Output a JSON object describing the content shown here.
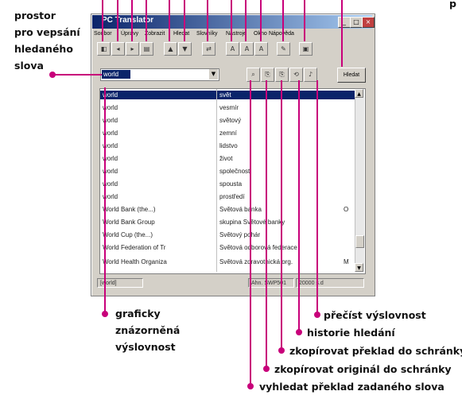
{
  "window": {
    "title": "PC Translator",
    "controls": [
      "_",
      "□",
      "×"
    ]
  },
  "menu": [
    "Soubor",
    "Úpravy",
    "Zobrazit",
    "Hledat",
    "Slovníky",
    "Nástroje",
    "Okno",
    "Nápověda"
  ],
  "search": {
    "value": "world",
    "button_label": "Hledat"
  },
  "results": [
    {
      "original": "world",
      "translation": "svět",
      "extra": ""
    },
    {
      "original": "world",
      "translation": "vesmír",
      "extra": ""
    },
    {
      "original": "world",
      "translation": "světový",
      "extra": ""
    },
    {
      "original": "world",
      "translation": "zemní",
      "extra": ""
    },
    {
      "original": "world",
      "translation": "lidstvo",
      "extra": ""
    },
    {
      "original": "world",
      "translation": "život",
      "extra": ""
    },
    {
      "original": "world",
      "translation": "společnost",
      "extra": ""
    },
    {
      "original": "world",
      "translation": "spousta",
      "extra": ""
    },
    {
      "original": "world",
      "translation": "prostředí",
      "extra": ""
    },
    {
      "original": "World Bank (the...)",
      "translation": "Světová banka",
      "extra": "O"
    },
    {
      "original": "World Bank Group",
      "translation": "skupina Světové banky",
      "extra": ""
    },
    {
      "original": "World Cup (the...)",
      "translation": "Světový pohár",
      "extra": ""
    },
    {
      "original": "World Federation of Tr",
      "translation": "Světová odborová federace",
      "extra": ""
    },
    {
      "original": "World Health Organiza",
      "translation": "Světová zdravotnická org.",
      "extra": "M"
    }
  ],
  "status": {
    "left": "[world]",
    "middle": "Ahn. SWP501",
    "right": "20000 s.d"
  },
  "annotations": {
    "search_field": [
      "prostor",
      "pro vepsání",
      "hledaného",
      "slova"
    ],
    "pronunciation": [
      "graficky",
      "znázorněná",
      "výslovnost"
    ],
    "read_pronunciation": "přečíst výslovnost",
    "history": "historie hledání",
    "copy_translation": "zkopírovat překlad do schránky",
    "copy_original": "zkopírovat originál do schránky",
    "find_translation": "vyhledat překlad zadaného slova",
    "top_right_partial": "p"
  },
  "colors": {
    "annotation_line": "#c8007a",
    "selection": "#0a246a"
  }
}
